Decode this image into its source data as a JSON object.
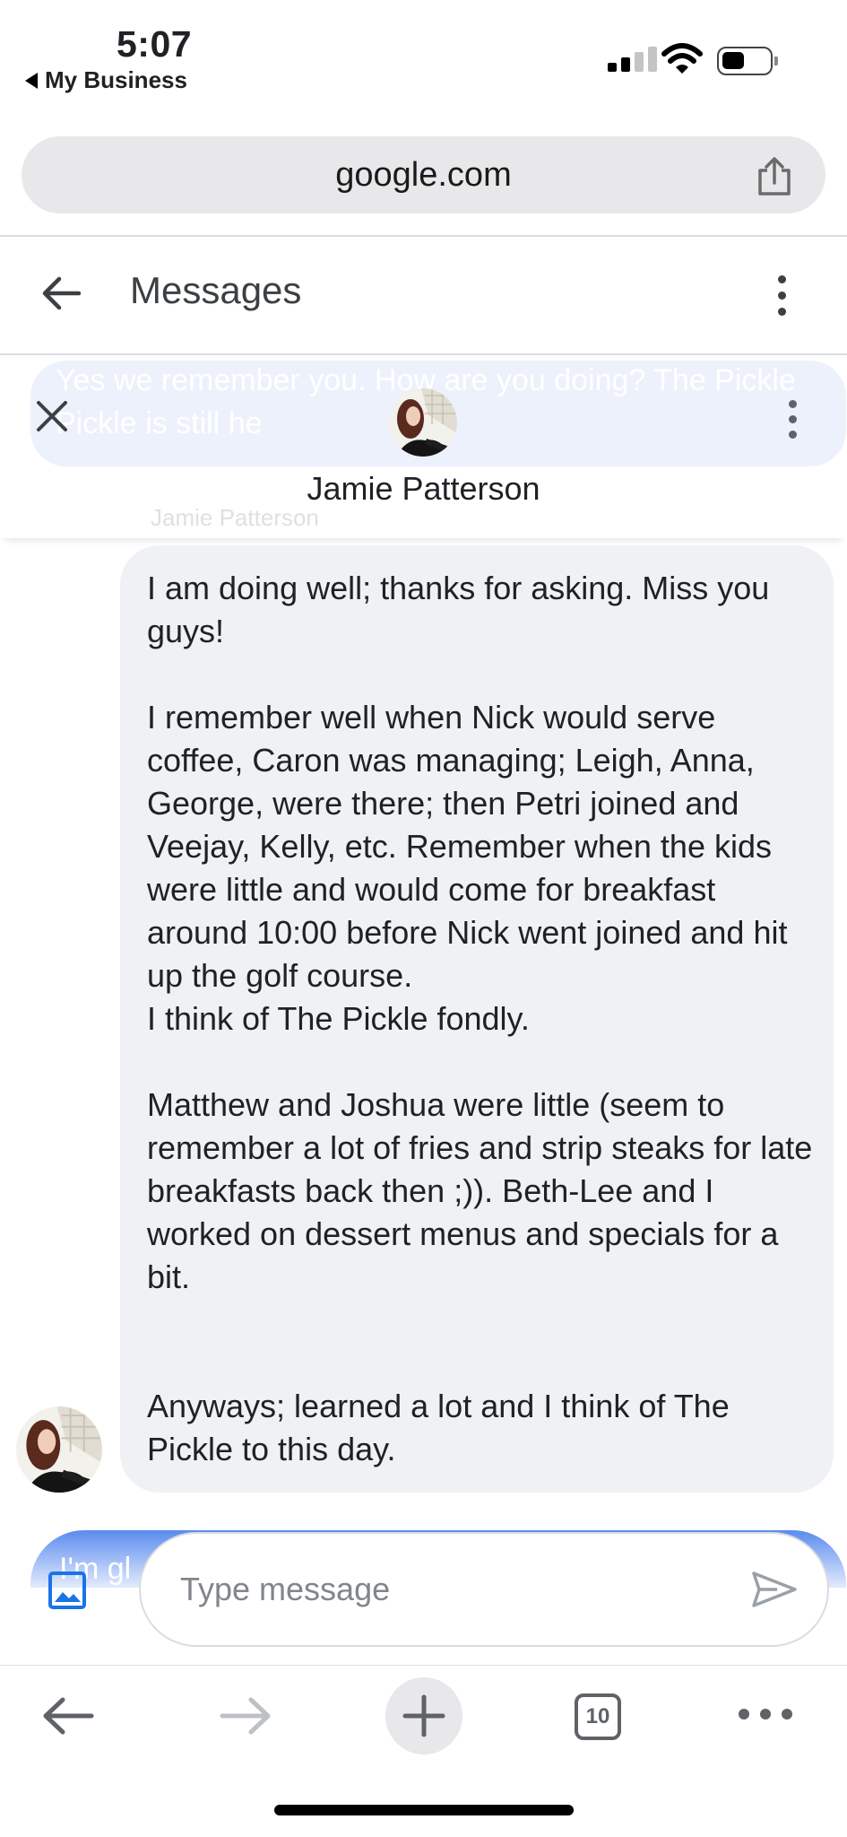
{
  "status_bar": {
    "time": "5:07",
    "back_app_label": "My Business",
    "icons": [
      "cellular-signal-icon",
      "wifi-icon",
      "battery-icon"
    ]
  },
  "browser": {
    "url": "google.com",
    "tab_count": "10",
    "toolbar_icons": [
      "back-icon",
      "forward-icon",
      "new-tab-icon",
      "tabs-icon",
      "more-icon"
    ]
  },
  "app_bar": {
    "title": "Messages"
  },
  "conversation": {
    "contact_name": "Jamie Patterson",
    "previous_message_partial": "Yes we remember you. How are you doing? The Pickle Pickle is still he",
    "sender_label": "Jamie Patterson",
    "message": {
      "paragraphs": [
        "I am doing well; thanks for asking. Miss you guys!",
        "I remember well when Nick would serve coffee, Caron was managing; Leigh, Anna, George, were there; then Petri joined and Veejay, Kelly, etc. Remember when the kids were little and would come for breakfast around 10:00 before Nick went joined and hit up the golf course.",
        "I think of The Pickle fondly.",
        "Matthew and Joshua were little (seem to remember a lot of fries and strip steaks for late breakfasts back then ;)). Beth-Lee and I worked on dessert menus and specials for a bit.",
        "Anyways; learned a lot and I think of The Pickle to this day."
      ]
    },
    "next_message_partial": "I'm gl"
  },
  "composer": {
    "placeholder": "Type message"
  },
  "colors": {
    "bubble_bg": "#f0f1f4",
    "accent_blue": "#1a73e8",
    "icon_gray": "#5f6368"
  }
}
